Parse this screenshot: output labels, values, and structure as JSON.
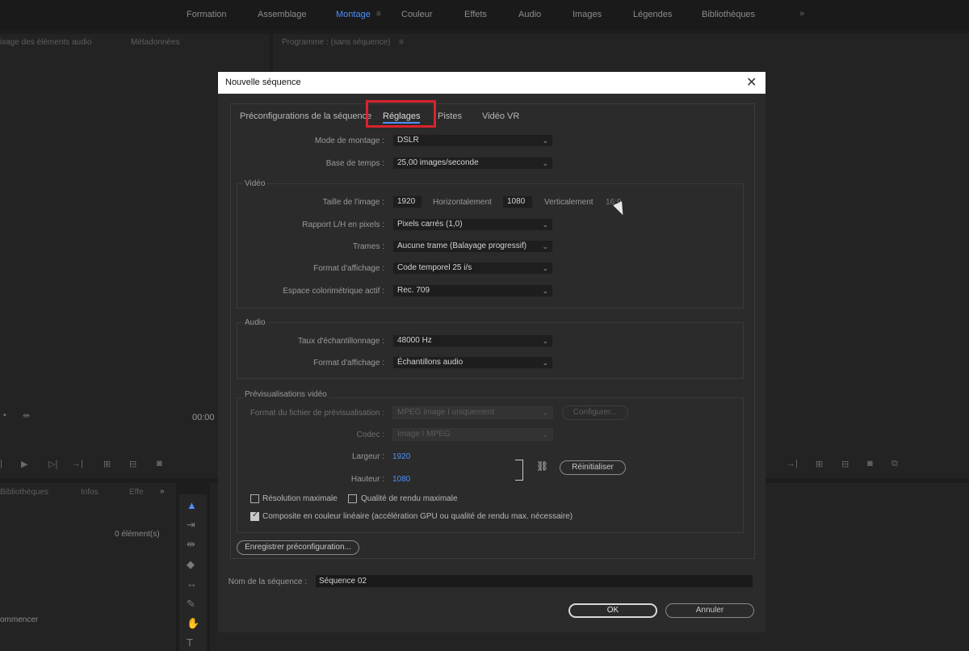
{
  "workspace": {
    "tabs": [
      "Formation",
      "Assemblage",
      "Montage",
      "Couleur",
      "Effets",
      "Audio",
      "Images",
      "Légendes",
      "Bibliothèques"
    ],
    "active_tab": "Montage",
    "more": "»"
  },
  "panels": {
    "source_tab1": "ixage des éléments audio",
    "source_tab2": "Métadonnées",
    "program_title": "Programme : (sans séquence)",
    "timecode": "00:00",
    "project_tabs": [
      "Bibliothèques",
      "Infos",
      "Effe"
    ],
    "element_count": "0 élément(s)",
    "start_text": "ommencer"
  },
  "dialog": {
    "title": "Nouvelle séquence",
    "tabs": [
      "Préconfigurations de la séquence",
      "Réglages",
      "Pistes",
      "Vidéo VR"
    ],
    "active_tab": "Réglages",
    "mode_label": "Mode de montage :",
    "mode_value": "DSLR",
    "timebase_label": "Base de temps :",
    "timebase_value": "25,00  images/seconde",
    "video": {
      "title": "Vidéo",
      "frame_size_label": "Taille de l'image :",
      "width": "1920",
      "horizontal_label": "Horizontalement",
      "height": "1080",
      "vertical_label": "Verticalement",
      "aspect": "16:9",
      "par_label": "Rapport L/H en pixels :",
      "par_value": "Pixels carrés (1,0)",
      "fields_label": "Trames :",
      "fields_value": "Aucune trame (Balayage progressif)",
      "display_label": "Format d'affichage :",
      "display_value": "Code temporel 25 i/s",
      "colorspace_label": "Espace colorimétrique actif :",
      "colorspace_value": "Rec. 709"
    },
    "audio": {
      "title": "Audio",
      "rate_label": "Taux d'échantillonnage :",
      "rate_value": "48000 Hz",
      "display_label": "Format d'affichage :",
      "display_value": "Échantillons audio"
    },
    "preview": {
      "title": "Prévisualisations vidéo",
      "format_label": "Format du fichier de prévisualisation :",
      "format_value": "MPEG image I uniquement",
      "configure_label": "Configurer...",
      "codec_label": "Codec :",
      "codec_value": "Image I MPEG",
      "width_label": "Largeur :",
      "width_value": "1920",
      "height_label": "Hauteur :",
      "height_value": "1080",
      "reset_label": "Réinitialiser"
    },
    "options": {
      "max_res": "Résolution maximale",
      "max_quality": "Qualité de rendu maximale",
      "linear": "Composite en couleur linéaire (accélération GPU ou qualité de rendu max. nécessaire)",
      "linear_checked": true
    },
    "save_preset": "Enregistrer préconfiguration...",
    "seq_name_label": "Nom de la séquence :",
    "seq_name": "Séquence 02",
    "ok": "OK",
    "cancel": "Annuler"
  }
}
